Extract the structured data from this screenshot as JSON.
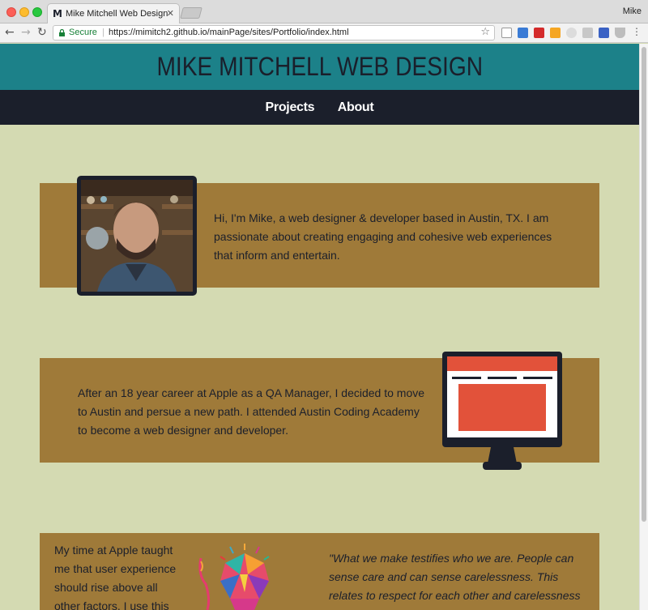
{
  "browser": {
    "tab_title": "Mike Mitchell Web Design",
    "tab_favicon": "M",
    "user_name": "Mike",
    "secure_label": "Secure",
    "url": "https://mimitch2.github.io/mainPage/sites/Portfolio/index.html",
    "colors": {
      "secure": "#188038"
    }
  },
  "site": {
    "title": "MIKE MITCHELL WEB DESIGN",
    "nav": {
      "projects": "Projects",
      "about": "About"
    },
    "colors": {
      "header_bg": "#1c8189",
      "nav_bg": "#1b1f2b",
      "page_bg": "#d4dab2",
      "band_bg": "#9f7a39",
      "accent": "#e2523a"
    }
  },
  "sections": {
    "intro_text": "Hi, I'm Mike, a web designer & developer based in Austin, TX. I am passionate about creating engaging and cohesive web experiences that inform and entertain.",
    "career_text": "After an 18 year career at Apple as a QA Manager, I decided to move to Austin and persue a new path. I attended Austin Coding Academy to become a web designer and developer.",
    "ux_text": "My time at Apple taught me that user experience should rise above all other factors. I use this as my",
    "quote_text": "\"What we make testifies who we are. People can sense care and can sense carelessness. This relates to respect for each other and carelessness is personally offensive.\""
  }
}
